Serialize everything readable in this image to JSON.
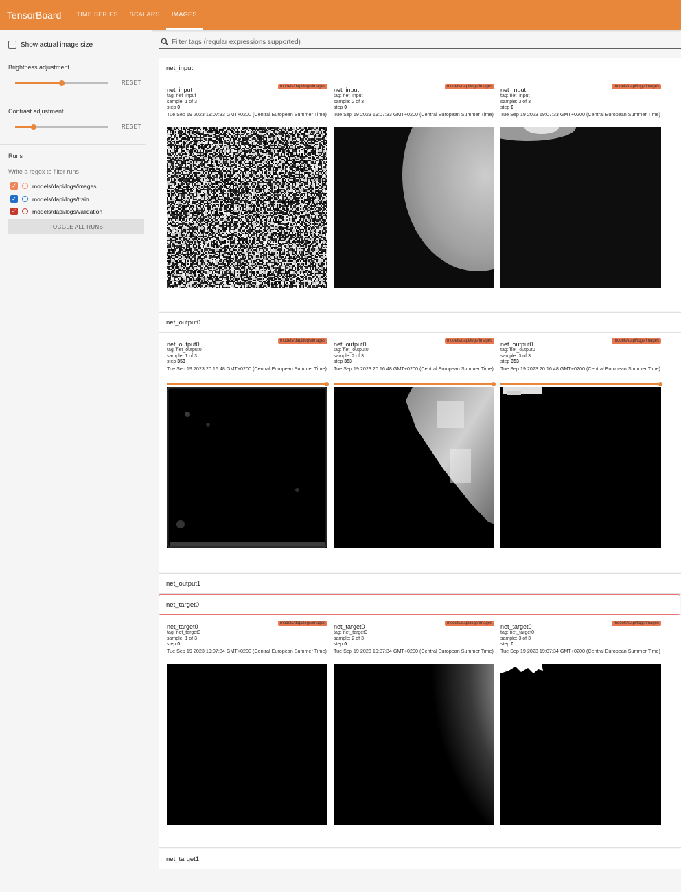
{
  "header": {
    "brand": "TensorBoard",
    "tabs": [
      {
        "label": "TIME SERIES",
        "active": false
      },
      {
        "label": "SCALARS",
        "active": false
      },
      {
        "label": "IMAGES",
        "active": true
      }
    ],
    "accent_color": "#e8863a"
  },
  "sidebar": {
    "show_actual_size_label": "Show actual image size",
    "show_actual_size_checked": false,
    "brightness": {
      "label": "Brightness adjustment",
      "value_fraction": 0.5,
      "reset_label": "RESET"
    },
    "contrast": {
      "label": "Contrast adjustment",
      "value_fraction": 0.2,
      "reset_label": "RESET"
    },
    "runs_label": "Runs",
    "runs_filter_placeholder": "Write a regex to filter runs",
    "runs": [
      {
        "name": "models/dapi/logs/images",
        "checked": true,
        "color": "#f0855a"
      },
      {
        "name": "models/dapi/logs/train",
        "checked": true,
        "color": "#1e6fc8"
      },
      {
        "name": "models/dapi/logs/validation",
        "checked": true,
        "color": "#c0392b"
      }
    ],
    "toggle_all_label": "TOGGLE ALL RUNS",
    "footer_mark": "."
  },
  "main": {
    "tag_filter_placeholder": "Filter tags (regular expressions supported)",
    "groups": [
      {
        "tag": "net_input",
        "cards": [
          {
            "name": "net_input",
            "run": "models/dapi/logs/images",
            "tag_line": "tag: net_input",
            "sample": "sample: 1 of 3",
            "step_prefix": "step",
            "step": "0",
            "timestamp": "Tue Sep 19 2023 19:07:33 GMT+0200 (Central European Summer Time)",
            "image": "noise"
          },
          {
            "name": "net_input",
            "run": "models/dapi/logs/images",
            "tag_line": "tag: net_input",
            "sample": "sample: 2 of 3",
            "step_prefix": "step",
            "step": "0",
            "timestamp": "Tue Sep 19 2023 19:07:33 GMT+0200 (Central European Summer Time)",
            "image": "cell-right"
          },
          {
            "name": "net_input",
            "run": "models/dapi/logs/images",
            "tag_line": "tag: net_input",
            "sample": "sample: 3 of 3",
            "step_prefix": "step",
            "step": "0",
            "timestamp": "Tue Sep 19 2023 19:07:33 GMT+0200 (Central European Summer Time)",
            "image": "edge-top"
          }
        ]
      },
      {
        "tag": "net_output0",
        "cards": [
          {
            "name": "net_output0",
            "run": "models/dapi/logs/images",
            "tag_line": "tag: net_output0",
            "sample": "sample: 1 of 3",
            "step_prefix": "step",
            "step": "353",
            "timestamp": "Tue Sep 19 2023 20:16:48 GMT+0200 (Central European Summer Time)",
            "image": "dark-blotch"
          },
          {
            "name": "net_output0",
            "run": "models/dapi/logs/images",
            "tag_line": "tag: net_output0",
            "sample": "sample: 2 of 3",
            "step_prefix": "step",
            "step": "353",
            "timestamp": "Tue Sep 19 2023 20:16:48 GMT+0200 (Central European Summer Time)",
            "image": "blocky-cell"
          },
          {
            "name": "net_output0",
            "run": "models/dapi/logs/images",
            "tag_line": "tag: net_output0",
            "sample": "sample: 3 of 3",
            "step_prefix": "step",
            "step": "353",
            "timestamp": "Tue Sep 19 2023 20:16:48 GMT+0200 (Central European Summer Time)",
            "image": "blocky-top"
          }
        ]
      },
      {
        "tag": "net_output1",
        "cards": []
      },
      {
        "tag": "net_target0",
        "highlighted": true,
        "cards": [
          {
            "name": "net_target0",
            "run": "models/dapi/logs/images",
            "tag_line": "tag: net_target0",
            "sample": "sample: 1 of 3",
            "step_prefix": "step",
            "step": "0",
            "timestamp": "Tue Sep 19 2023 19:07:34 GMT+0200 (Central European Summer Time)",
            "image": "black"
          },
          {
            "name": "net_target0",
            "run": "models/dapi/logs/images",
            "tag_line": "tag: net_target0",
            "sample": "sample: 2 of 3",
            "step_prefix": "step",
            "step": "0",
            "timestamp": "Tue Sep 19 2023 19:07:34 GMT+0200 (Central European Summer Time)",
            "image": "smooth-cell"
          },
          {
            "name": "net_target0",
            "run": "models/dapi/logs/images",
            "tag_line": "tag: net_target0",
            "sample": "sample: 3 of 3",
            "step_prefix": "step",
            "step": "0",
            "timestamp": "Tue Sep 19 2023 19:07:34 GMT+0200 (Central European Summer Time)",
            "image": "wavy-top"
          }
        ]
      },
      {
        "tag": "net_target1",
        "cards": []
      }
    ]
  }
}
